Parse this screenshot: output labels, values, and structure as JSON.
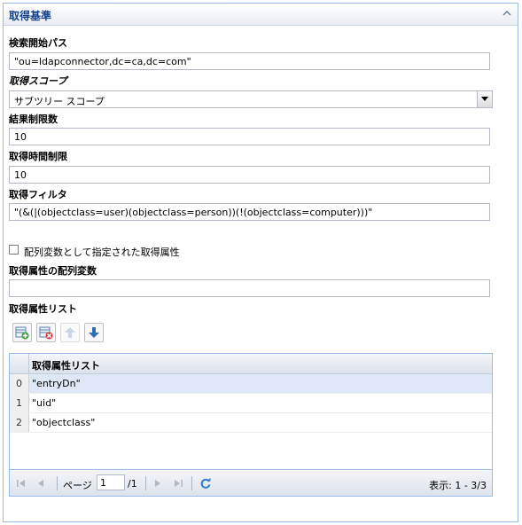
{
  "panel": {
    "title": "取得基準"
  },
  "fields": {
    "search_base_label": "検索開始パス",
    "search_base_value": "\"ou=ldapconnector,dc=ca,dc=com\"",
    "scope_label": "取得スコープ",
    "scope_value": "サブツリー スコープ",
    "result_limit_label": "結果制限数",
    "result_limit_value": "10",
    "time_limit_label": "取得時間制限",
    "time_limit_value": "10",
    "filter_label": "取得フィルタ",
    "filter_value": "\"(&(|(objectclass=user)(objectclass=person))(!(objectclass=computer)))\"",
    "array_checkbox_label": "配列変数として指定された取得属性",
    "array_var_label": "取得属性の配列変数",
    "array_var_value": "",
    "attr_list_label": "取得属性リスト"
  },
  "toolbar": {
    "add_icon": "add-row-icon",
    "delete_icon": "delete-row-icon",
    "up_icon": "arrow-up-icon",
    "down_icon": "arrow-down-icon"
  },
  "grid": {
    "column_header": "取得属性リスト",
    "rows": [
      {
        "index": "0",
        "value": "\"entryDn\""
      },
      {
        "index": "1",
        "value": "\"uid\""
      },
      {
        "index": "2",
        "value": "\"objectclass\""
      }
    ]
  },
  "pager": {
    "page_label": "ページ",
    "current_page": "1",
    "of_total": "/1",
    "display_text": "表示: 1 - 3/3"
  },
  "colors": {
    "accent": "#15428b",
    "border": "#99bbe8",
    "selected_row": "#dfe8f6"
  }
}
